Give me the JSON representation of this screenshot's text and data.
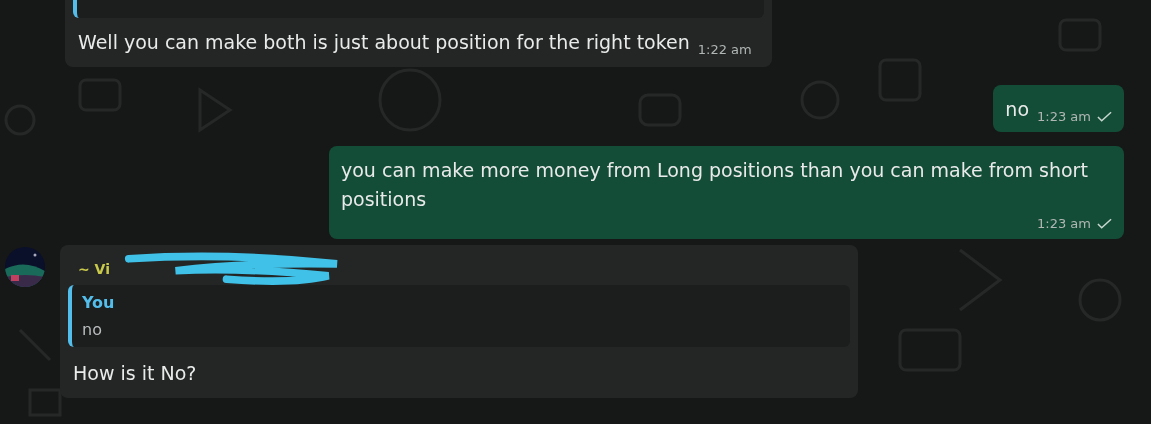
{
  "messages": [
    {
      "kind": "in",
      "cut_top": true,
      "quote": {
        "cut": true
      },
      "text": "Well you can make both is just about position for the right token",
      "time": "1:22 am"
    },
    {
      "kind": "out",
      "text": "no",
      "time": "1:23 am",
      "tick": true
    },
    {
      "kind": "out",
      "text": "you can make more money from Long positions than you can make from short positions",
      "time": "1:23 am",
      "tick": true
    },
    {
      "kind": "in",
      "avatar": true,
      "sender": "~ Vi",
      "quote": {
        "author": "You",
        "text": "no"
      },
      "text": "How is it No?"
    }
  ]
}
